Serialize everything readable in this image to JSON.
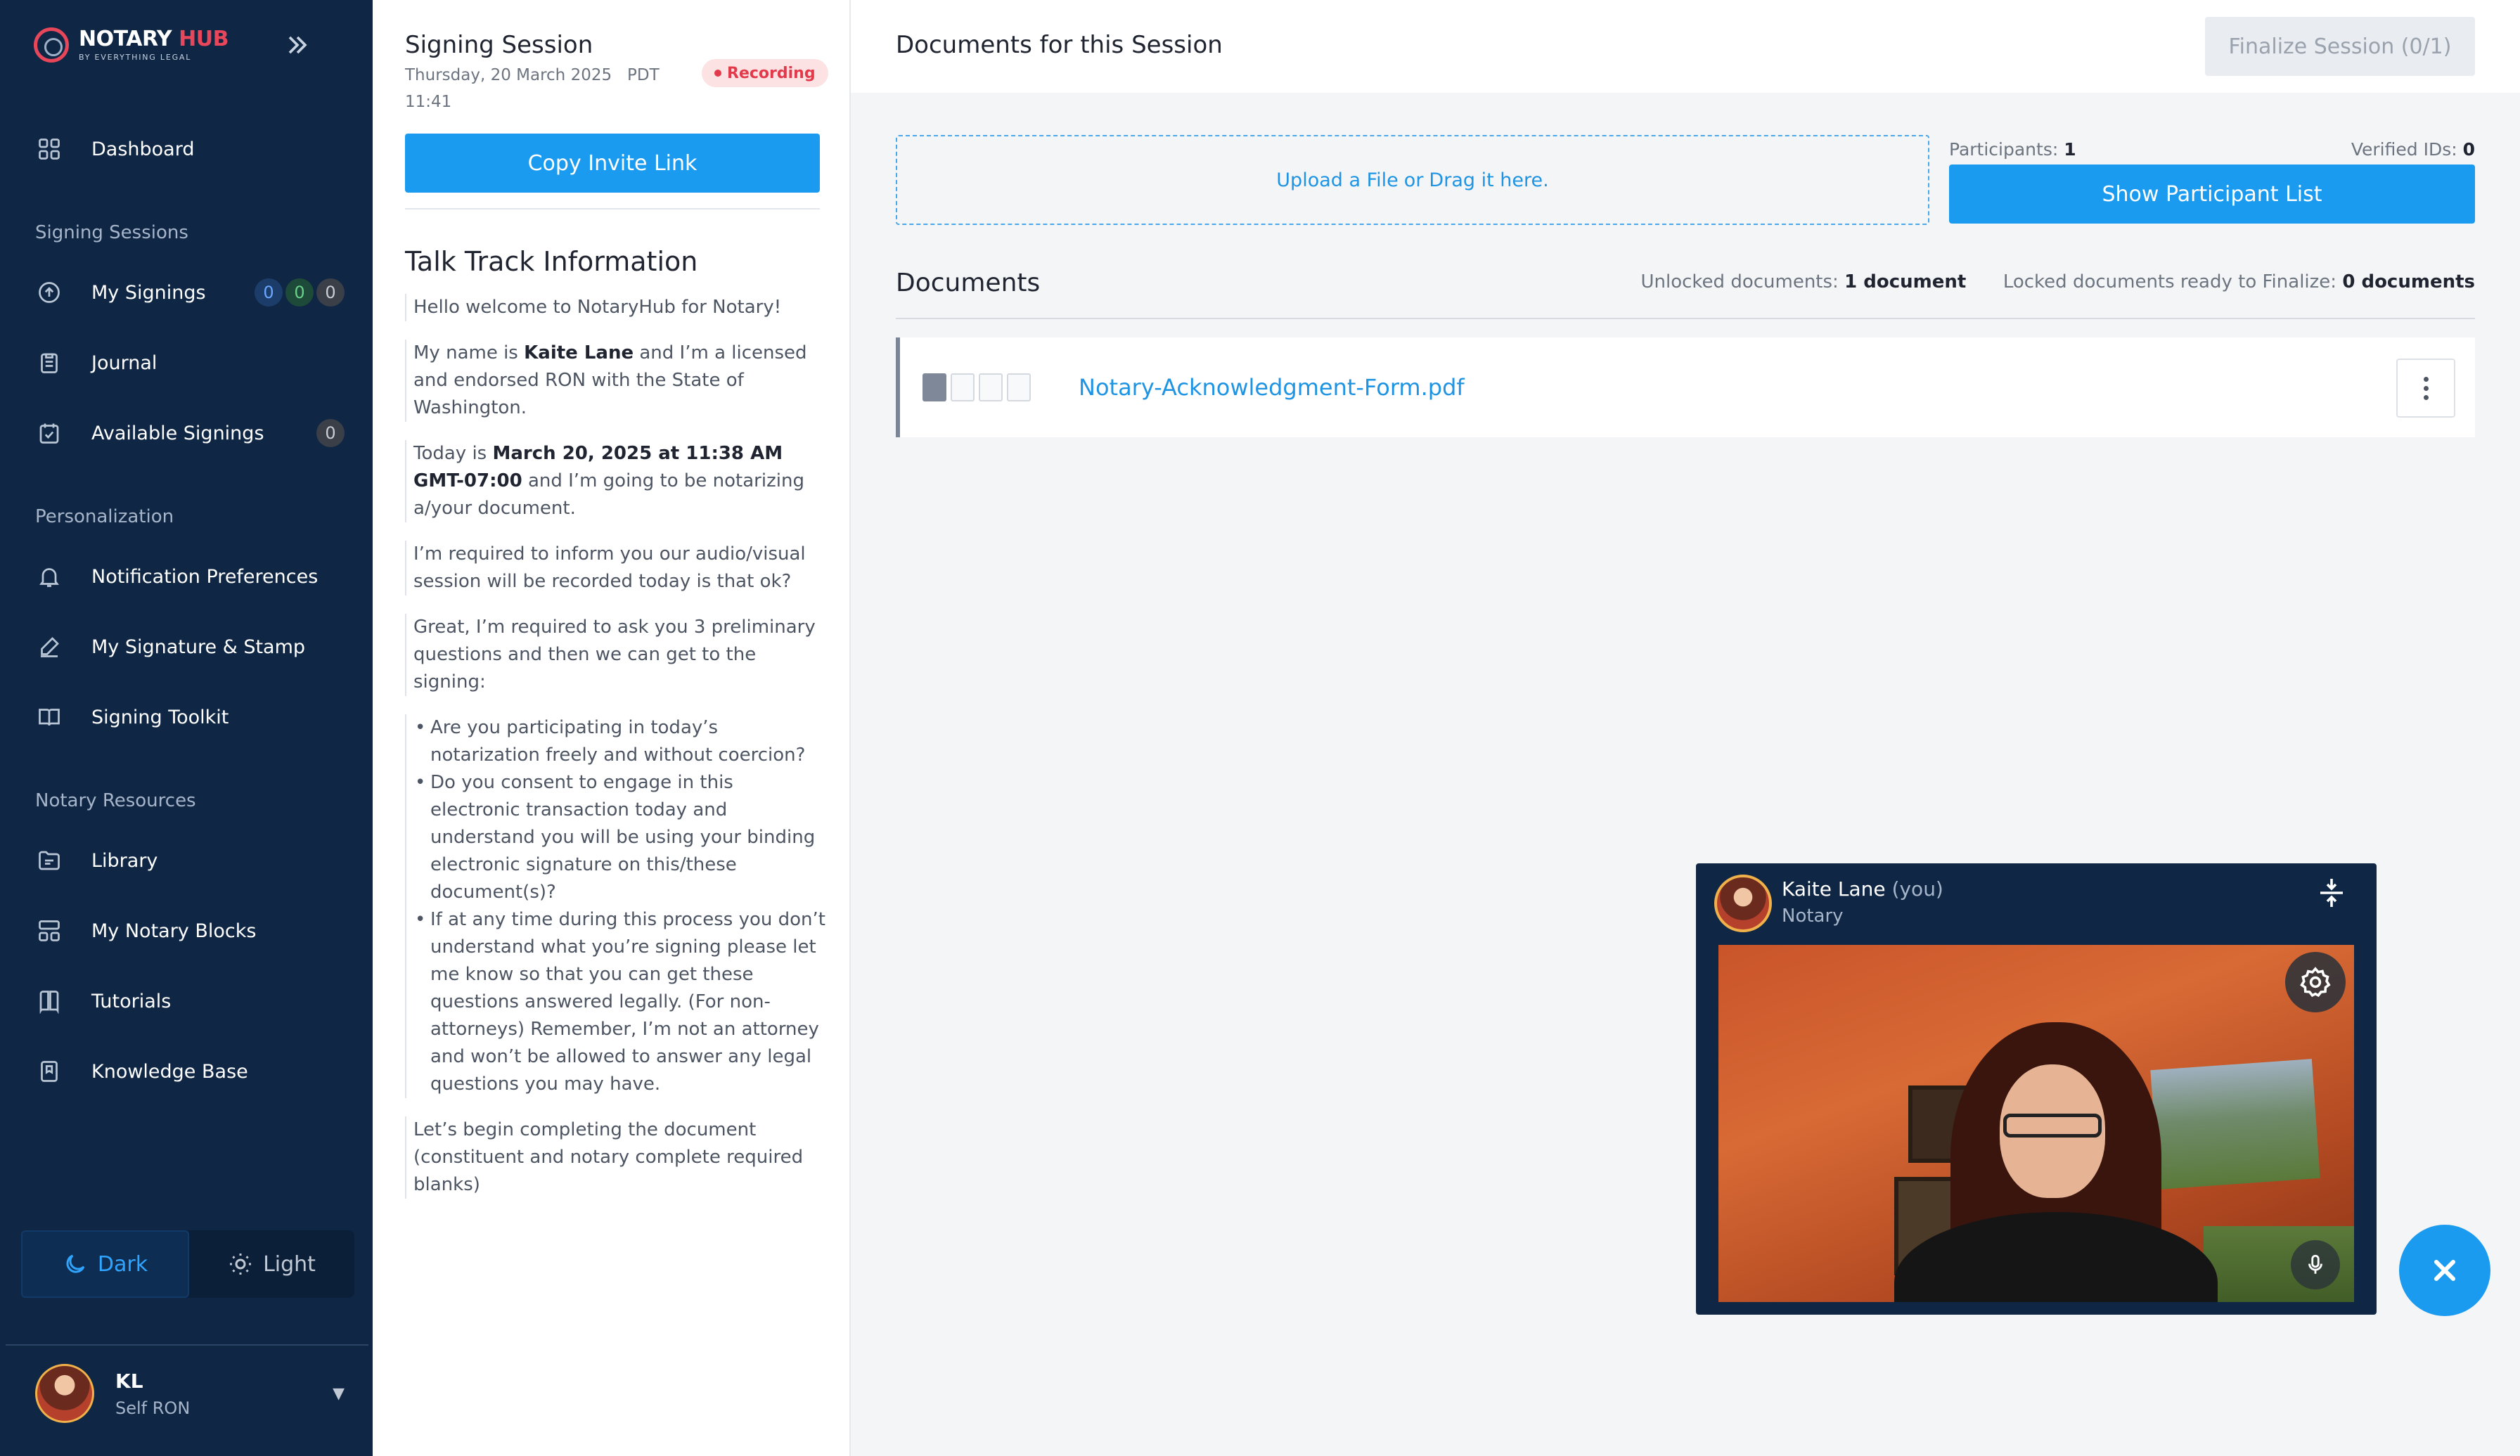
{
  "app": {
    "brand_main": "NOTARY",
    "brand_accent": "HUB",
    "brand_sub": "BY EVERYTHING LEGAL",
    "accent_color": "#1a9bf0",
    "brand_color": "#e8465a"
  },
  "sidebar": {
    "dashboard": {
      "label": "Dashboard",
      "icon": "dashboard-grid-icon"
    },
    "section_signing": "Signing Sessions",
    "my_signings": {
      "label": "My Signings",
      "icon": "upload-circle-icon",
      "badges": [
        "0",
        "0",
        "0"
      ]
    },
    "journal": {
      "label": "Journal",
      "icon": "clipboard-icon"
    },
    "available_signings": {
      "label": "Available Signings",
      "icon": "calendar-check-icon",
      "badge": "0"
    },
    "section_personalization": "Personalization",
    "notification_prefs": {
      "label": "Notification Preferences",
      "icon": "bell-icon"
    },
    "signature_stamp": {
      "label": "My Signature & Stamp",
      "icon": "pen-icon"
    },
    "signing_toolkit": {
      "label": "Signing Toolkit",
      "icon": "book-open-icon"
    },
    "section_resources": "Notary Resources",
    "library": {
      "label": "Library",
      "icon": "folder-icon"
    },
    "notary_blocks": {
      "label": "My Notary Blocks",
      "icon": "blocks-icon"
    },
    "tutorials": {
      "label": "Tutorials",
      "icon": "book-icon"
    },
    "knowledge_base": {
      "label": "Knowledge Base",
      "icon": "bookmark-icon"
    },
    "theme": {
      "dark": "Dark",
      "light": "Light",
      "selected": "Dark"
    },
    "user": {
      "initials": "KL",
      "role": "Self RON"
    }
  },
  "session": {
    "title": "Signing Session",
    "date": "Thursday, 20 March 2025",
    "tz": "PDT",
    "time": "11:41",
    "recording_label": "Recording",
    "copy_invite_label": "Copy Invite Link",
    "talk_track_title": "Talk Track Information",
    "p1": "Hello welcome to NotaryHub for Notary!",
    "p2_a": "My name is ",
    "p2_name": "Kaite Lane",
    "p2_b": " and I’m a licensed and endorsed RON with the State of Washington.",
    "p3_a": "Today is ",
    "p3_date": "March 20, 2025 at 11:38 AM GMT-07:00",
    "p3_b": " and I’m going to be notarizing a/your document.",
    "p4": "I’m required to inform you our audio/visual session will be recorded today is that ok?",
    "p5": "Great, I’m required to ask you 3 preliminary questions and then we can get to the signing:",
    "q1": "Are you participating in today’s notarization freely and without coercion?",
    "q2": "Do you consent to engage in this electronic transaction today and understand you will be using your binding electronic signature on this/these document(s)?",
    "q3": "If at any time during this process you don’t understand what you’re signing please let me know so that you can get these questions answered legally. (For non-attorneys) Remember, I’m not an attorney and won’t be allowed to answer any legal questions you may have.",
    "p6": "Let’s begin completing the document (constituent and notary complete required blanks)"
  },
  "main": {
    "title": "Documents for this Session",
    "finalize_label": "Finalize Session (0/1)",
    "upload_link": "Upload a File",
    "upload_or": "or",
    "upload_drag": "Drag it here.",
    "participants_label": "Participants:",
    "participants_count": "1",
    "verified_label": "Verified IDs:",
    "verified_count": "0",
    "show_list_label": "Show Participant List",
    "documents_title": "Documents",
    "unlocked_label": "Unlocked documents:",
    "unlocked_value": "1 document",
    "locked_label": "Locked documents ready to Finalize:",
    "locked_value": "0 documents",
    "documents": [
      {
        "name": "Notary-Acknowledgment-Form.pdf"
      }
    ]
  },
  "video": {
    "name": "Kaite Lane",
    "you_label": "(you)",
    "role": "Notary"
  }
}
